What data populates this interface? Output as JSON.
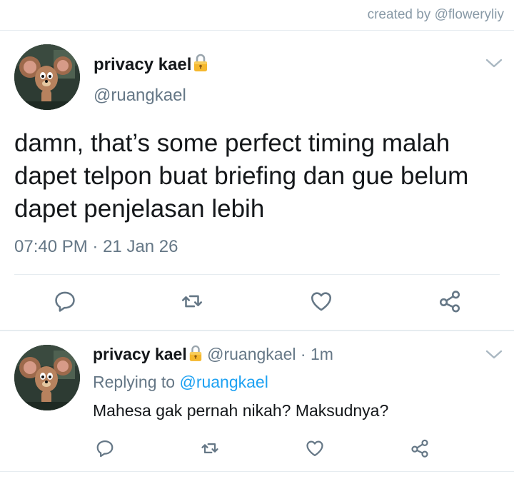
{
  "credit": "created by @floweryliy",
  "main_tweet": {
    "display_name": "privacy kael",
    "handle": "@ruangkael",
    "text": "damn, that’s some perfect timing malah dapet telpon buat briefing dan gue belum dapet penjelasan lebih",
    "time": "07:40 PM",
    "separator": "·",
    "date": "21 Jan 26"
  },
  "reply_tweet": {
    "display_name": "privacy kael",
    "handle": "@ruangkael",
    "separator": "·",
    "age": "1m",
    "replying_prefix": "Replying to",
    "replying_to": "@ruangkael",
    "text": "Mahesa gak pernah nikah? Maksudnya?"
  },
  "icons": {
    "reply": "reply-icon",
    "retweet": "retweet-icon",
    "like": "heart-icon",
    "share": "share-icon",
    "menu": "chevron-down-icon",
    "protected": "lock-icon"
  },
  "colors": {
    "text": "#14171a",
    "secondary": "#657786",
    "icon": "#657786",
    "link": "#1da1f2",
    "divider": "#e6ecf0",
    "lock": "#f5b82e"
  }
}
